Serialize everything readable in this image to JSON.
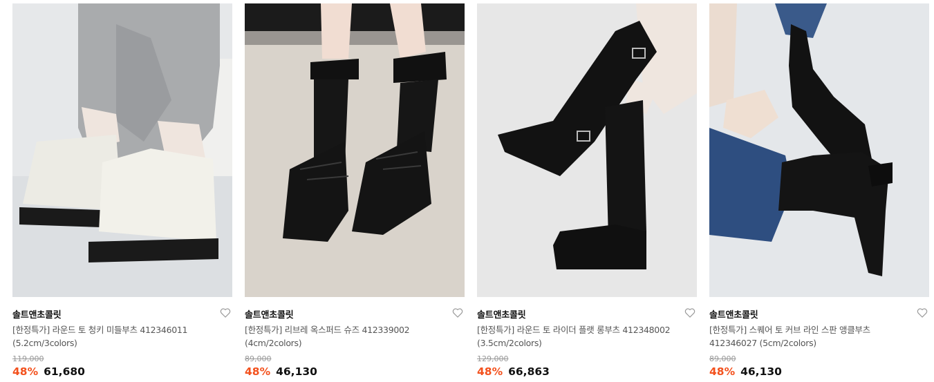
{
  "products": [
    {
      "brand": "솔트앤초콜릿",
      "name": "[한정특가] 라운드 토 청키 미들부츠 412346011 (5.2cm/3colors)",
      "original_price": "119,000",
      "discount": "48%",
      "price": "61,680",
      "image": "white-chunky-middle-boots-photo",
      "wish_icon": "heart-outline-icon"
    },
    {
      "brand": "솔트앤초콜릿",
      "name": "[한정특가] 리브레 옥스퍼드 슈즈 412339002 (4cm/2colors)",
      "original_price": "89,000",
      "discount": "48%",
      "price": "46,130",
      "image": "black-oxford-shoes-photo",
      "wish_icon": "heart-outline-icon"
    },
    {
      "brand": "솔트앤초콜릿",
      "name": "[한정특가] 라운드 토 라이더 플랫 롱부츠 412348002 (3.5cm/2colors)",
      "original_price": "129,000",
      "discount": "48%",
      "price": "66,863",
      "image": "black-rider-long-boots-photo",
      "wish_icon": "heart-outline-icon"
    },
    {
      "brand": "솔트앤초콜릿",
      "name": "[한정특가] 스퀘어 토 커브 라인 스판 앵클부츠 412346027 (5cm/2colors)",
      "original_price": "89,000",
      "discount": "48%",
      "price": "46,130",
      "image": "black-square-toe-ankle-boots-photo",
      "wish_icon": "heart-outline-icon"
    }
  ],
  "colors": {
    "discount": "#f3511d",
    "price": "#111111",
    "original_price": "#999999",
    "name": "#555555"
  }
}
